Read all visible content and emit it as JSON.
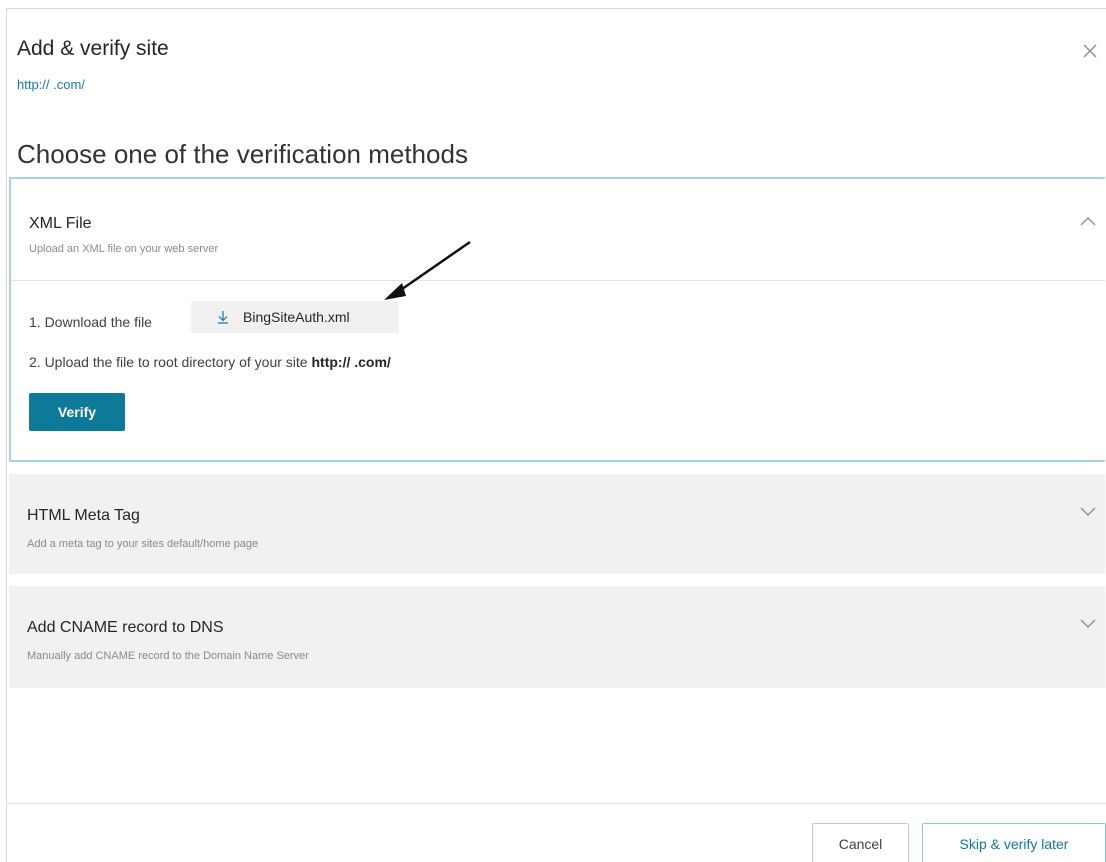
{
  "dialog": {
    "title": "Add & verify site",
    "site_url": "http://                              .com/",
    "close_icon": "close-icon"
  },
  "heading": "Choose one of the verification methods",
  "methods": [
    {
      "title": "XML File",
      "subtitle": "Upload an XML file on your web server",
      "expanded": true,
      "step1_label": "1. Download the file",
      "download_label": "BingSiteAuth.xml",
      "step2_label": "2. Upload the file to root directory of your site",
      "step2_url": "http://                              .com/",
      "verify_label": "Verify"
    },
    {
      "title": "HTML Meta Tag",
      "subtitle": "Add a meta tag to your sites default/home page",
      "expanded": false
    },
    {
      "title": "Add CNAME record to DNS",
      "subtitle": "Manually add CNAME record to the Domain Name Server",
      "expanded": false
    }
  ],
  "footer": {
    "cancel_label": "Cancel",
    "skip_label": "Skip & verify later"
  },
  "colors": {
    "accent": "#0e7a9a",
    "link": "#1b7aa3",
    "panel_bg": "#f1f1f1",
    "card_border": "#a9d3df"
  }
}
